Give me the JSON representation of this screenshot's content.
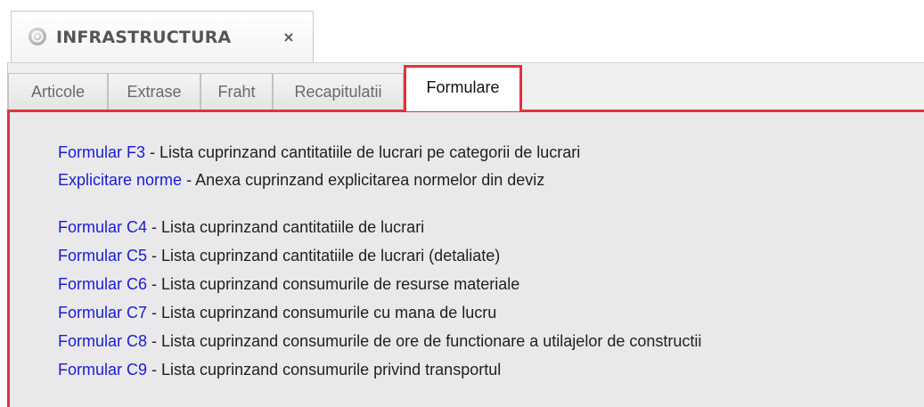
{
  "document_tab": {
    "title": "INFRASTRUCTURA",
    "close_glyph": "×",
    "icon": "app-logo-icon"
  },
  "sub_tabs": [
    {
      "label": "Articole",
      "active": false
    },
    {
      "label": "Extrase",
      "active": false
    },
    {
      "label": "Fraht",
      "active": false
    },
    {
      "label": "Recapitulatii",
      "active": false
    },
    {
      "label": "Formulare",
      "active": true
    }
  ],
  "accent_color": "#e0333b",
  "link_color": "#1a1ad6",
  "forms": [
    {
      "link": "Formular F3",
      "description": " - Lista cuprinzand cantitatiile de lucrari pe categorii de lucrari"
    },
    {
      "link": "Explicitare norme",
      "description": " - Anexa cuprinzand explicitarea normelor din deviz"
    },
    {
      "link": "Formular C4",
      "description": " - Lista cuprinzand cantitatiile de lucrari"
    },
    {
      "link": "Formular C5",
      "description": " - Lista cuprinzand cantitatiile de lucrari (detaliate)"
    },
    {
      "link": "Formular C6",
      "description": " - Lista cuprinzand consumurile de resurse materiale"
    },
    {
      "link": "Formular C7",
      "description": " - Lista cuprinzand consumurile cu mana de lucru"
    },
    {
      "link": "Formular C8",
      "description": " - Lista cuprinzand consumurile de ore de functionare a utilajelor de constructii"
    },
    {
      "link": "Formular C9",
      "description": " - Lista cuprinzand consumurile privind transportul"
    }
  ]
}
